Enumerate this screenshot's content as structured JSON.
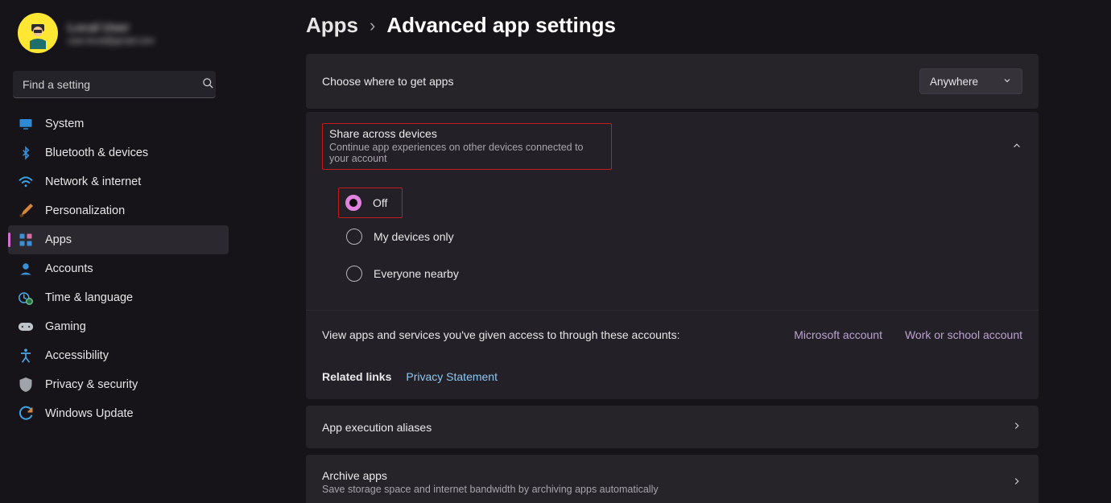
{
  "user": {
    "name": "Local User",
    "email": "user.local@gmail.com"
  },
  "search": {
    "placeholder": "Find a setting"
  },
  "sidebar": {
    "items": [
      {
        "label": "System",
        "icon": "display-icon"
      },
      {
        "label": "Bluetooth & devices",
        "icon": "bluetooth-icon"
      },
      {
        "label": "Network & internet",
        "icon": "wifi-icon"
      },
      {
        "label": "Personalization",
        "icon": "brush-icon"
      },
      {
        "label": "Apps",
        "icon": "apps-icon"
      },
      {
        "label": "Accounts",
        "icon": "person-icon"
      },
      {
        "label": "Time & language",
        "icon": "clock-globe-icon"
      },
      {
        "label": "Gaming",
        "icon": "gamepad-icon"
      },
      {
        "label": "Accessibility",
        "icon": "accessibility-icon"
      },
      {
        "label": "Privacy & security",
        "icon": "shield-icon"
      },
      {
        "label": "Windows Update",
        "icon": "update-icon"
      }
    ],
    "active_index": 4
  },
  "breadcrumb": {
    "root": "Apps",
    "leaf": "Advanced app settings"
  },
  "sections": {
    "source": {
      "title": "Choose where to get apps",
      "dropdown_value": "Anywhere"
    },
    "share": {
      "title": "Share across devices",
      "desc": "Continue app experiences on other devices connected to your account",
      "options": [
        "Off",
        "My devices only",
        "Everyone nearby"
      ],
      "selected_index": 0
    },
    "access": {
      "text": "View apps and services you've given access to through these accounts:",
      "links": [
        "Microsoft account",
        "Work or school account"
      ]
    },
    "related": {
      "label": "Related links",
      "links": [
        "Privacy Statement"
      ]
    },
    "aliases": {
      "title": "App execution aliases"
    },
    "archive": {
      "title": "Archive apps",
      "desc": "Save storage space and internet bandwidth by archiving apps automatically"
    }
  }
}
